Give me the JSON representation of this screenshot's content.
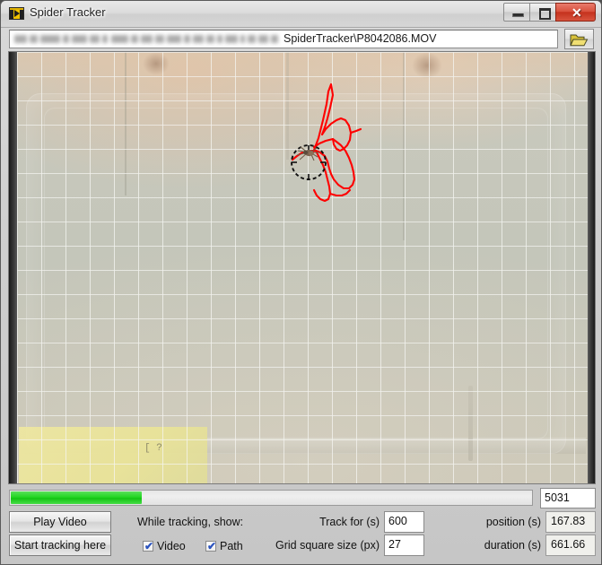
{
  "window": {
    "title": "Spider Tracker",
    "app_icon": "labview-icon",
    "minimize_label": "",
    "maximize_label": "",
    "close_label": "✕"
  },
  "path_bar": {
    "icon": "open-folder-icon",
    "redacted_prefix": "(blurred path prefix)",
    "value": "SpiderTracker\\P8042086.MOV",
    "browse_label": ""
  },
  "video": {
    "sticky_note_mark": "[ ?",
    "camera_watermark": "",
    "grid": {
      "spacing_px": 27,
      "color": "#f2f2ee"
    },
    "tracker": {
      "circle_color": "#111111",
      "path_color": "#ff0000"
    }
  },
  "progress": {
    "percent": 25,
    "frame_counter": "5031"
  },
  "controls": {
    "play_video_label": "Play Video",
    "start_tracking_label": "Start tracking here",
    "while_tracking_label": "While tracking, show:",
    "video_checkbox": {
      "label": "Video",
      "checked": true,
      "tick": "✔"
    },
    "path_checkbox": {
      "label": "Path",
      "checked": true,
      "tick": "✔"
    },
    "track_for_label": "Track for (s)",
    "track_for_value": "600",
    "grid_square_size_label": "Grid square size (px)",
    "grid_square_size_value": "27",
    "position_label": "position (s)",
    "position_value": "167.83",
    "duration_label": "duration (s)",
    "duration_value": "661.66"
  },
  "colors": {
    "progress_green": "#1fd01f",
    "close_red": "#c4301c",
    "track_red": "#ff0000",
    "note_yellow": "#eee79f"
  }
}
